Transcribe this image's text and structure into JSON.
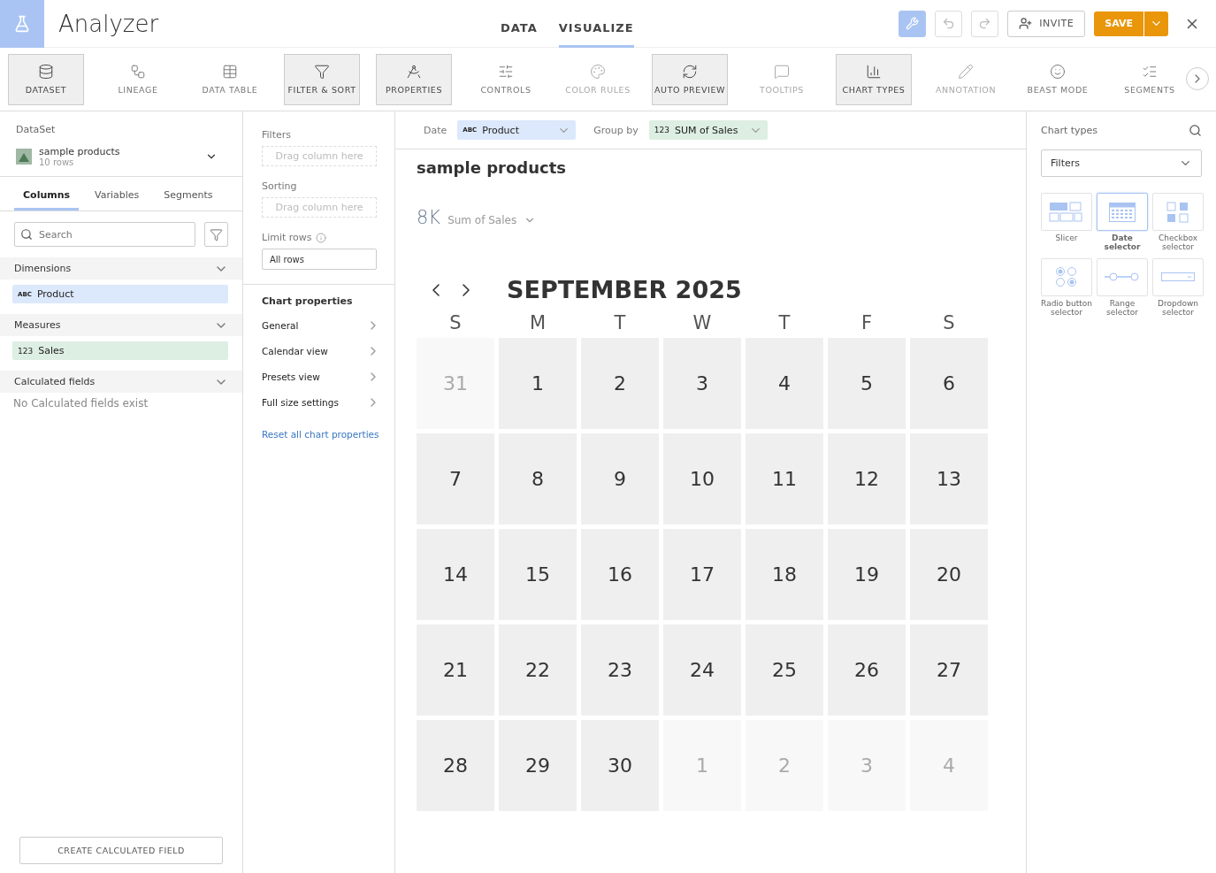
{
  "app": {
    "title": "Analyzer"
  },
  "main_tabs": [
    {
      "label": "DATA",
      "selected": false
    },
    {
      "label": "VISUALIZE",
      "selected": true
    }
  ],
  "header_buttons": {
    "invite": "INVITE",
    "save": "SAVE"
  },
  "toolbar": [
    {
      "label": "DATASET",
      "selected": true,
      "disabled": false
    },
    {
      "label": "LINEAGE",
      "selected": false,
      "disabled": false
    },
    {
      "label": "DATA TABLE",
      "selected": false,
      "disabled": false
    },
    {
      "label": "FILTER & SORT",
      "selected": true,
      "disabled": false
    },
    {
      "label": "PROPERTIES",
      "selected": true,
      "disabled": false
    },
    {
      "label": "CONTROLS",
      "selected": false,
      "disabled": false
    },
    {
      "label": "COLOR RULES",
      "selected": false,
      "disabled": true
    },
    {
      "label": "AUTO PREVIEW",
      "selected": true,
      "disabled": false
    },
    {
      "label": "TOOLTIPS",
      "selected": false,
      "disabled": true
    },
    {
      "label": "CHART TYPES",
      "selected": true,
      "disabled": false
    },
    {
      "label": "ANNOTATION",
      "selected": false,
      "disabled": true
    },
    {
      "label": "BEAST MODE",
      "selected": false,
      "disabled": false
    },
    {
      "label": "SEGMENTS",
      "selected": false,
      "disabled": false
    }
  ],
  "dataset_panel": {
    "heading": "DataSet",
    "name": "sample products",
    "rows": "10 rows",
    "tabs": [
      {
        "label": "Columns",
        "selected": true
      },
      {
        "label": "Variables",
        "selected": false
      },
      {
        "label": "Segments",
        "selected": false
      }
    ],
    "search": {
      "placeholder": "Search"
    },
    "sections": [
      {
        "title": "Dimensions",
        "expanded": true,
        "items": [
          {
            "type": "ABC",
            "name": "Product",
            "kind": "dimension"
          }
        ]
      },
      {
        "title": "Measures",
        "expanded": true,
        "items": [
          {
            "type": "123",
            "name": "Sales",
            "kind": "measure"
          }
        ]
      },
      {
        "title": "Calculated fields",
        "expanded": true,
        "empty": "No Calculated fields exist"
      }
    ],
    "create_button": "CREATE CALCULATED FIELD"
  },
  "filter_panel": {
    "filters": {
      "label": "Filters",
      "placeholder": "Drag column here"
    },
    "sorting": {
      "label": "Sorting",
      "placeholder": "Drag column here"
    },
    "limit": {
      "label": "Limit rows",
      "value": "All rows"
    },
    "chart_properties": {
      "title": "Chart properties",
      "items": [
        "General",
        "Calendar view",
        "Presets view",
        "Full size settings"
      ],
      "reset": "Reset all chart properties"
    }
  },
  "chart_bar": {
    "date_label": "Date",
    "date_value": {
      "type": "ABC",
      "name": "Product"
    },
    "group_label": "Group by",
    "group_value": {
      "type": "123",
      "name": "SUM of Sales"
    }
  },
  "chart": {
    "title": "sample products",
    "metric_value": "8K",
    "metric_label": "Sum of Sales",
    "month": "SEPTEMBER 2025",
    "weekdays": [
      "S",
      "M",
      "T",
      "W",
      "T",
      "F",
      "S"
    ],
    "days": [
      {
        "label": "31",
        "kind": "other"
      },
      {
        "label": "1",
        "kind": "month"
      },
      {
        "label": "2",
        "kind": "month"
      },
      {
        "label": "3",
        "kind": "month"
      },
      {
        "label": "4",
        "kind": "month"
      },
      {
        "label": "5",
        "kind": "month"
      },
      {
        "label": "6",
        "kind": "month"
      },
      {
        "label": "7",
        "kind": "month"
      },
      {
        "label": "8",
        "kind": "month"
      },
      {
        "label": "9",
        "kind": "month"
      },
      {
        "label": "10",
        "kind": "month"
      },
      {
        "label": "11",
        "kind": "month"
      },
      {
        "label": "12",
        "kind": "month"
      },
      {
        "label": "13",
        "kind": "month"
      },
      {
        "label": "14",
        "kind": "month"
      },
      {
        "label": "15",
        "kind": "month"
      },
      {
        "label": "16",
        "kind": "month"
      },
      {
        "label": "17",
        "kind": "month"
      },
      {
        "label": "18",
        "kind": "month"
      },
      {
        "label": "19",
        "kind": "month"
      },
      {
        "label": "20",
        "kind": "month"
      },
      {
        "label": "21",
        "kind": "month"
      },
      {
        "label": "22",
        "kind": "month"
      },
      {
        "label": "23",
        "kind": "month"
      },
      {
        "label": "24",
        "kind": "month"
      },
      {
        "label": "25",
        "kind": "month"
      },
      {
        "label": "26",
        "kind": "month"
      },
      {
        "label": "27",
        "kind": "month"
      },
      {
        "label": "28",
        "kind": "month"
      },
      {
        "label": "29",
        "kind": "month"
      },
      {
        "label": "30",
        "kind": "month"
      },
      {
        "label": "1",
        "kind": "other"
      },
      {
        "label": "2",
        "kind": "other"
      },
      {
        "label": "3",
        "kind": "other"
      },
      {
        "label": "4",
        "kind": "other"
      }
    ]
  },
  "chart_types_panel": {
    "title": "Chart types",
    "category": "Filters",
    "types": [
      {
        "label": "Slicer",
        "kind": "slicer",
        "selected": false
      },
      {
        "label": "Date selector",
        "kind": "date",
        "selected": true
      },
      {
        "label": "Checkbox selector",
        "kind": "checkbox",
        "selected": false
      },
      {
        "label": "Radio button selector",
        "kind": "radio",
        "selected": false
      },
      {
        "label": "Range selector",
        "kind": "range",
        "selected": false
      },
      {
        "label": "Dropdown selector",
        "kind": "dropdown",
        "selected": false
      }
    ]
  }
}
